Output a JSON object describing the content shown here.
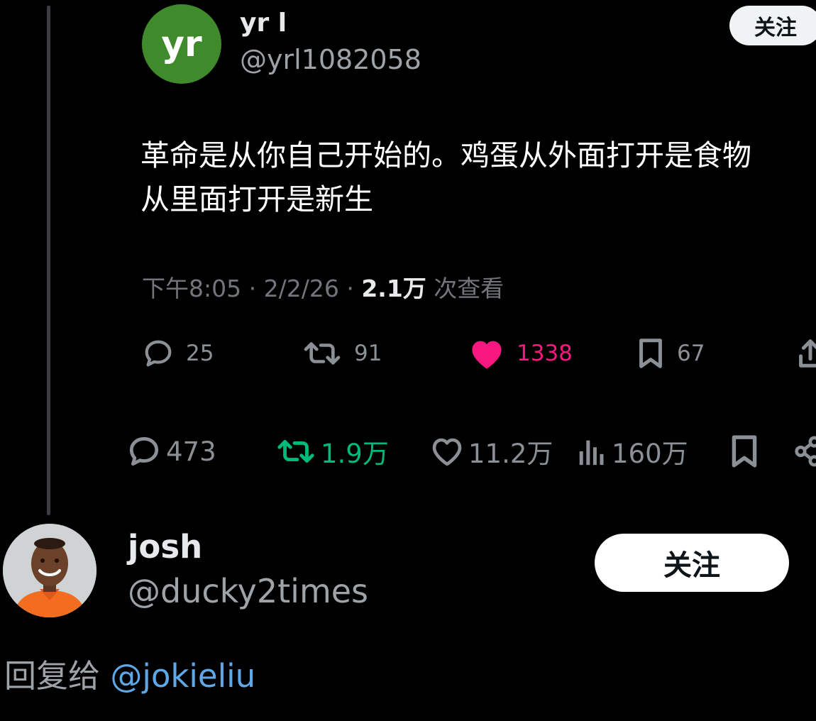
{
  "quoted_tweet": {
    "avatar_text": "yr",
    "name": "yr l",
    "handle": "@yrl1082058",
    "follow_label": "关注",
    "text_line1": "革命是从你自己开始的。鸡蛋从外面打开是食物",
    "text_line2": "从里面打开是新生",
    "time": "下午8:05",
    "date": "2/2/26",
    "views_count": "2.1万",
    "views_label": "次查看",
    "replies": "25",
    "retweets": "91",
    "likes": "1338",
    "bookmarks": "67",
    "colors": {
      "avatar": "#3f8a2a",
      "like": "#f91880"
    }
  },
  "reply_stats": {
    "replies": "473",
    "retweets": "1.9万",
    "likes": "11.2万",
    "views": "160万",
    "colors": {
      "retweet": "#00ba7c"
    }
  },
  "reply_tweet": {
    "name": "josh",
    "handle": "@ducky2times",
    "follow_label": "关注",
    "reply_to_label": "回复给",
    "reply_to_handle": "@jokieliu"
  }
}
